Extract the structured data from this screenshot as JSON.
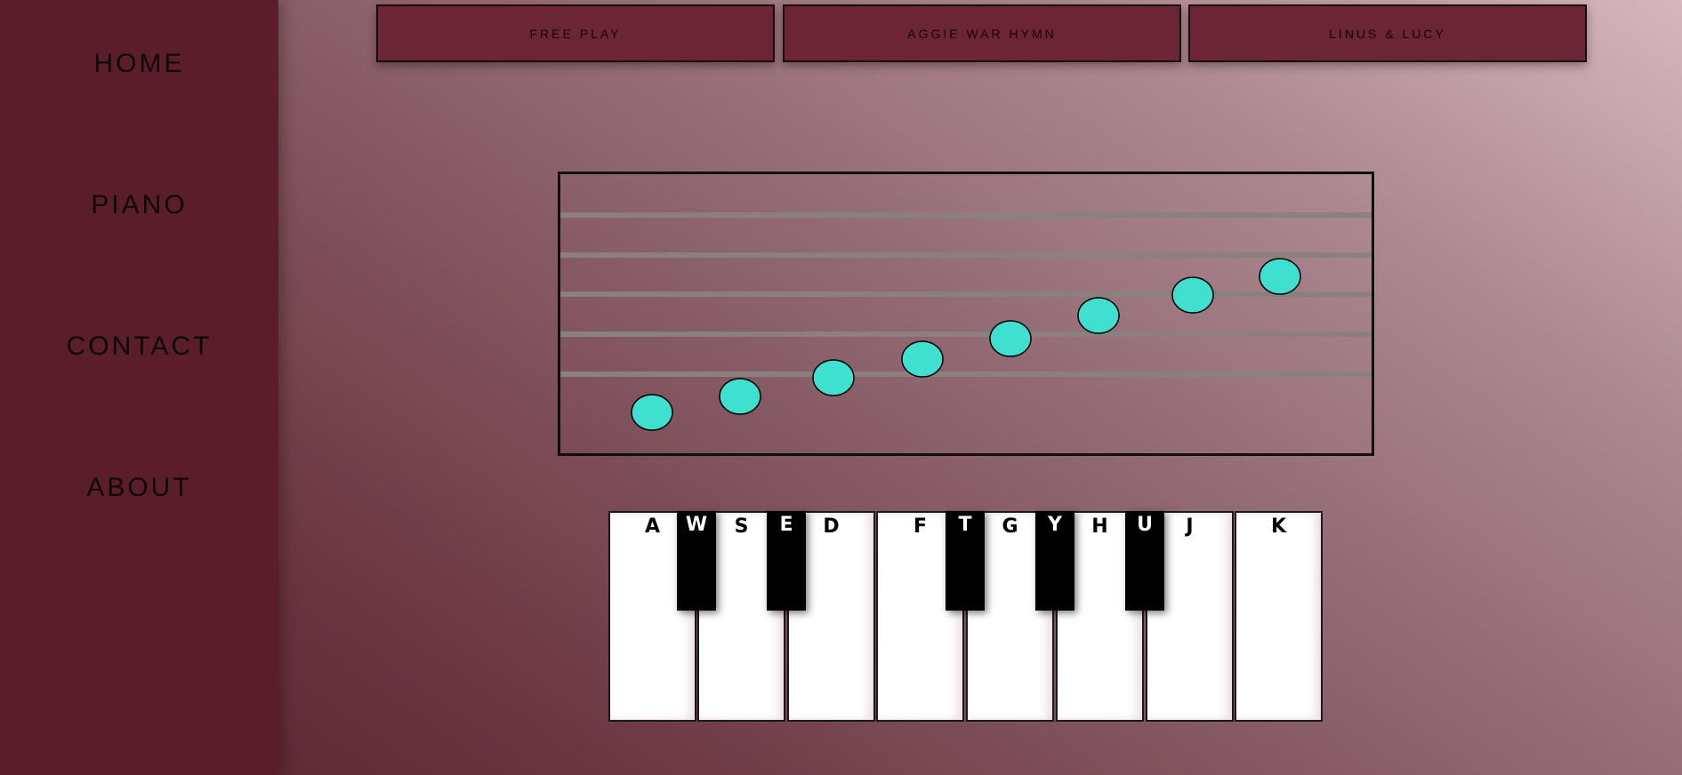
{
  "sidebar": {
    "items": [
      {
        "label": "HOME"
      },
      {
        "label": "PIANO"
      },
      {
        "label": "CONTACT"
      },
      {
        "label": "ABOUT"
      }
    ]
  },
  "modes": [
    {
      "label": "FREE PLAY"
    },
    {
      "label": "AGGIE WAR HYMN"
    },
    {
      "label": "LINUS & LUCY"
    }
  ],
  "piano": {
    "white_keys": [
      {
        "label": "A"
      },
      {
        "label": "S"
      },
      {
        "label": "D"
      },
      {
        "label": "F"
      },
      {
        "label": "G"
      },
      {
        "label": "H"
      },
      {
        "label": "J"
      },
      {
        "label": "K"
      }
    ],
    "black_keys": [
      {
        "label": "W"
      },
      {
        "label": "E"
      },
      {
        "label": "T"
      },
      {
        "label": "Y"
      },
      {
        "label": "U"
      }
    ]
  },
  "colors": {
    "note_fill": "#40e0d0",
    "staff_line": "#8a8080",
    "accent": "#6c2535"
  }
}
